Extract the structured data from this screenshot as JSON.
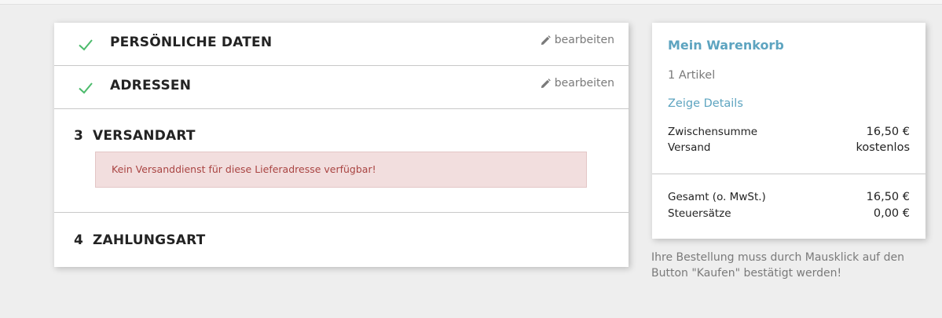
{
  "steps": [
    {
      "title": "PERSÖNLICHE DATEN",
      "edit_label": "bearbeiten",
      "status": "complete"
    },
    {
      "title": "ADRESSEN",
      "edit_label": "bearbeiten",
      "status": "complete"
    },
    {
      "number": "3",
      "title": "VERSANDART",
      "alert": "Kein Versanddienst für diese Lieferadresse verfügbar!"
    },
    {
      "number": "4",
      "title": "ZAHLUNGSART"
    }
  ],
  "cart": {
    "title": "Mein Warenkorb",
    "item_count": "1 Artikel",
    "details_link": "Zeige Details",
    "subtotal_label": "Zwischensumme",
    "subtotal_value": "16,50 €",
    "shipping_label": "Versand",
    "shipping_value": "kostenlos",
    "total_label": "Gesamt (o. MwSt.)",
    "total_value": "16,50 €",
    "tax_label": "Steuersätze",
    "tax_value": "0,00 €"
  },
  "confirmation_note": "Ihre Bestellung muss durch Mausklick auf den Button \"Kaufen\" bestätigt werden!",
  "colors": {
    "check": "#4cbb6c",
    "accent": "#5da4c0",
    "alert_bg": "#f2dede",
    "alert_text": "#a94442"
  },
  "icons": {
    "complete": "check-icon",
    "edit": "pencil-icon"
  }
}
